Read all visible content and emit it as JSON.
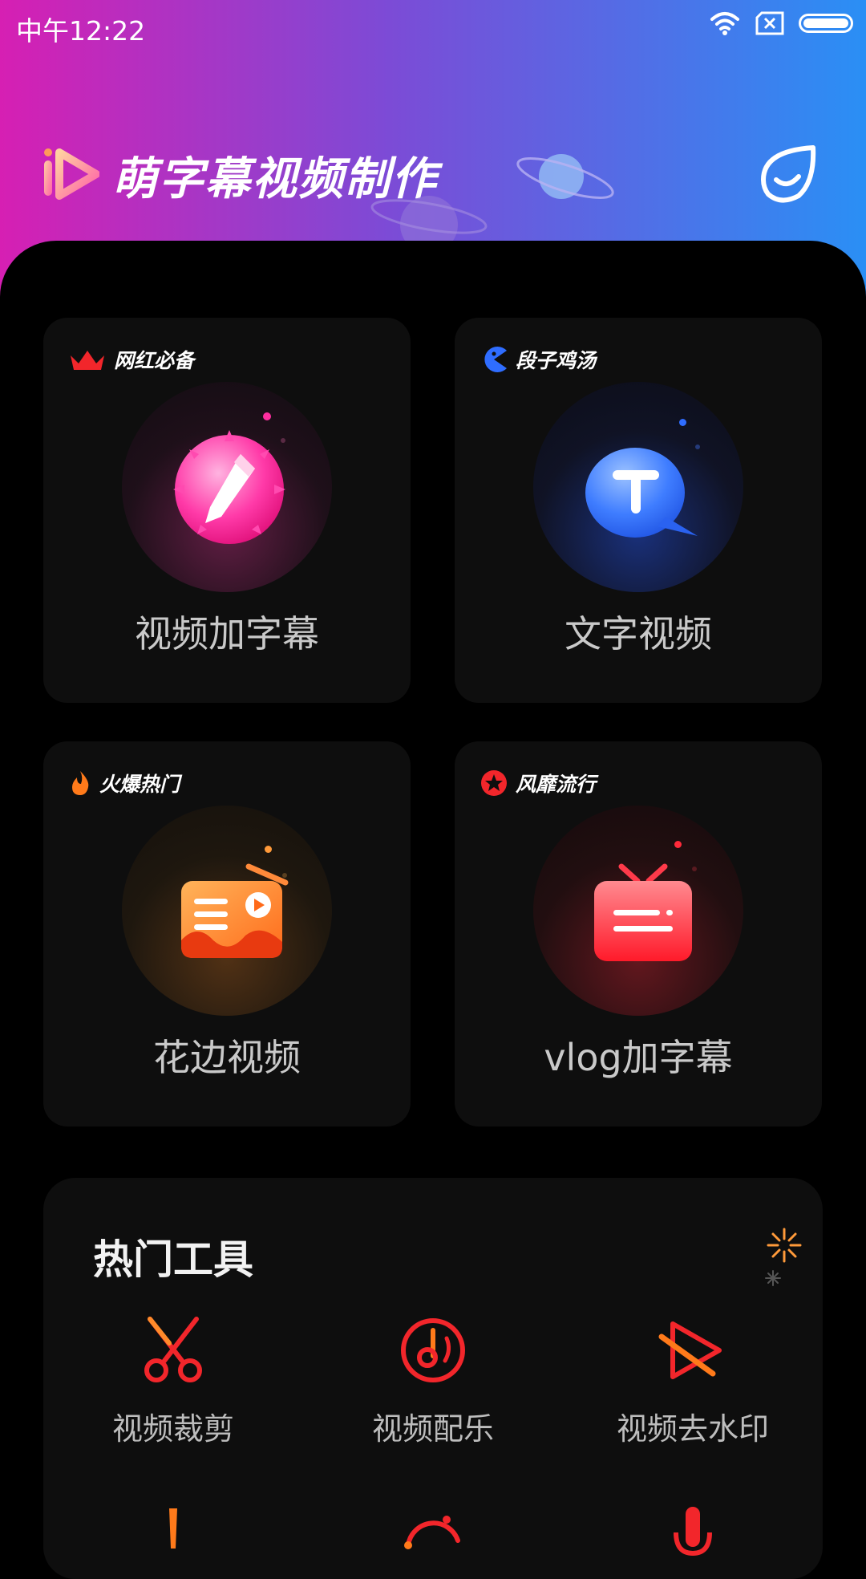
{
  "status_bar": {
    "time": "中午12:22"
  },
  "header": {
    "app_title": "萌字幕视频制作"
  },
  "cards": [
    {
      "tag": "网红必备",
      "label": "视频加字幕",
      "icon": "pencil-bubble-icon",
      "accent": "#ff2ea0"
    },
    {
      "tag": "段子鸡汤",
      "label": "文字视频",
      "icon": "text-chat-bubble-icon",
      "accent": "#2f6dff"
    },
    {
      "tag": "火爆热门",
      "label": "花边视频",
      "icon": "radio-icon",
      "accent": "#ff7a1a"
    },
    {
      "tag": "风靡流行",
      "label": "vlog加字幕",
      "icon": "tv-icon",
      "accent": "#ff2a3a"
    }
  ],
  "tools": {
    "title": "热门工具",
    "items": [
      {
        "label": "视频裁剪",
        "icon": "scissors-icon"
      },
      {
        "label": "视频配乐",
        "icon": "music-disc-icon"
      },
      {
        "label": "视频去水印",
        "icon": "play-slash-icon"
      },
      {
        "label": "",
        "icon": "exclamation-icon"
      },
      {
        "label": "",
        "icon": "gif-icon"
      },
      {
        "label": "",
        "icon": "microphone-icon"
      }
    ]
  },
  "colors": {
    "accent_red": "#f2262b",
    "gradient_start": "#d61fb3",
    "gradient_end": "#2a8ff5"
  }
}
